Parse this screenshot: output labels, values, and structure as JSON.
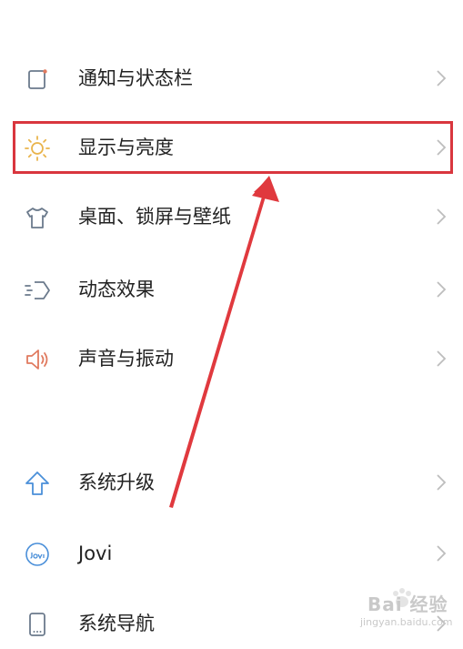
{
  "settings": {
    "items": [
      {
        "label": "通知与状态栏",
        "icon": "notification-icon"
      },
      {
        "label": "显示与亮度",
        "icon": "brightness-icon"
      },
      {
        "label": "桌面、锁屏与壁纸",
        "icon": "shirt-icon"
      },
      {
        "label": "动态效果",
        "icon": "motion-icon"
      },
      {
        "label": "声音与振动",
        "icon": "speaker-icon"
      },
      {
        "label": "系统升级",
        "icon": "upgrade-arrow-icon"
      },
      {
        "label": "Jovi",
        "icon": "jovi-icon"
      },
      {
        "label": "系统导航",
        "icon": "phone-navigation-icon"
      }
    ]
  },
  "annotation": {
    "highlight_color": "#d9363e",
    "arrow_color": "#e0393e"
  },
  "watermark": {
    "text": "Bai 经验",
    "sub": "jingyan.baidu.com"
  },
  "colors": {
    "icon_default": "#6b7a8c",
    "icon_brightness": "#e9b44c",
    "icon_speaker": "#e07a5f",
    "icon_notification_dot": "#e07a5f",
    "icon_upgrade": "#4a8fd9",
    "icon_jovi": "#4a8fd9",
    "chevron": "#bdbdbd"
  }
}
